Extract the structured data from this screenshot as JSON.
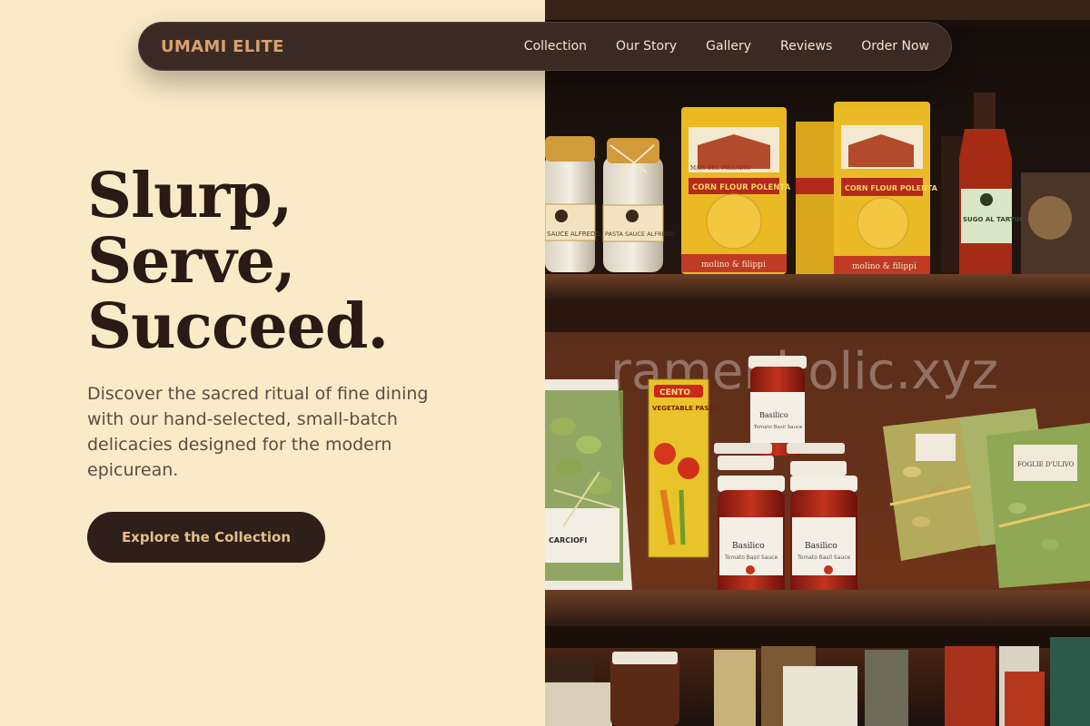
{
  "brand": "UMAMI ELITE",
  "nav": {
    "items": [
      "Collection",
      "Our Story",
      "Gallery",
      "Reviews",
      "Order Now"
    ]
  },
  "hero": {
    "title_lines": [
      "Slurp,",
      "Serve,",
      "Succeed."
    ],
    "description": "Discover the sacred ritual of fine dining with our hand-selected, small-batch delicacies designed for the modern epicurean.",
    "cta_label": "Explore the Collection"
  },
  "image": {
    "watermark": "ramenholic.xyz",
    "labels": {
      "jar1": "SAUCE ALFREDO",
      "jar2": "PASTA SAUCE ALFREDO",
      "polenta_brand": "MAIS DEL PALLADIO",
      "polenta": "CORN FLOUR POLENTA",
      "polenta_maker": "molino & filippi",
      "bottle": "SUGO AL TARTUFO",
      "cento_brand": "CENTO",
      "cento": "VEGETABLE PASTE",
      "sauce": "Basilico",
      "sauce_sub": "Tomato Basil Sauce",
      "cracker": "CARCIOFI",
      "bag": "FOGLIE D'ULIVO"
    }
  },
  "colors": {
    "background": "#f9ebc8",
    "nav_background": "#3b2a24",
    "brand": "#d9a071",
    "cta_background": "#2e1f1b",
    "cta_text": "#e7bf86"
  }
}
